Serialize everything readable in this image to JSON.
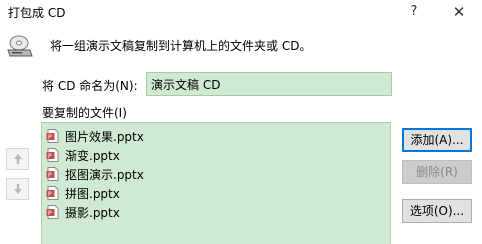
{
  "window": {
    "title": "打包成 CD",
    "help_label": "?",
    "close_label": "✕"
  },
  "description": "将一组演示文稿复制到计算机上的文件夹或 CD。",
  "cd_name": {
    "label": "将 CD 命名为(N):",
    "value": "演示文稿 CD"
  },
  "files": {
    "label": "要复制的文件(I)",
    "items": [
      {
        "name": "图片效果.pptx",
        "icon": "pptx-file-icon"
      },
      {
        "name": "渐变.pptx",
        "icon": "pptx-file-icon"
      },
      {
        "name": "抠图演示.pptx",
        "icon": "pptx-file-icon"
      },
      {
        "name": "拼图.pptx",
        "icon": "pptx-file-icon"
      },
      {
        "name": "摄影.pptx",
        "icon": "pptx-file-icon"
      }
    ]
  },
  "buttons": {
    "add": "添加(A)...",
    "remove": "删除(R)",
    "options": "选项(O)..."
  },
  "colors": {
    "list_background": "#cfe9d3",
    "primary_border": "#0078d7",
    "file_icon": "#c0504d"
  }
}
